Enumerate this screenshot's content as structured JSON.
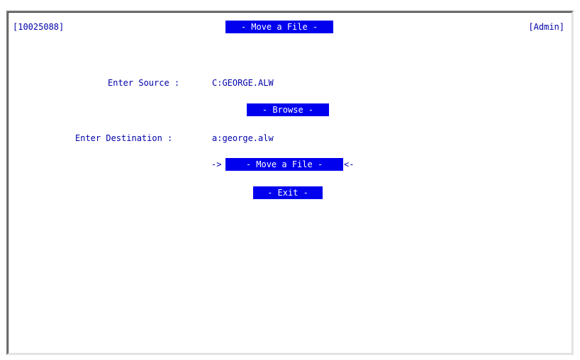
{
  "header": {
    "session_id": "[10025088]",
    "title": "- Move a File -",
    "user": "[Admin]"
  },
  "form": {
    "source_label": "Enter Source :",
    "source_value": "C:GEORGE.ALW",
    "browse_label": "- Browse -",
    "destination_label": "Enter Destination :",
    "destination_value": "a:george.alw",
    "move_label": "- Move a File -",
    "move_arrow_left": "->",
    "move_arrow_right": "<-",
    "exit_label": "- Exit -"
  },
  "colors": {
    "text": "#0000aa",
    "button_bg": "#0000ee",
    "button_text": "#ffffff"
  }
}
